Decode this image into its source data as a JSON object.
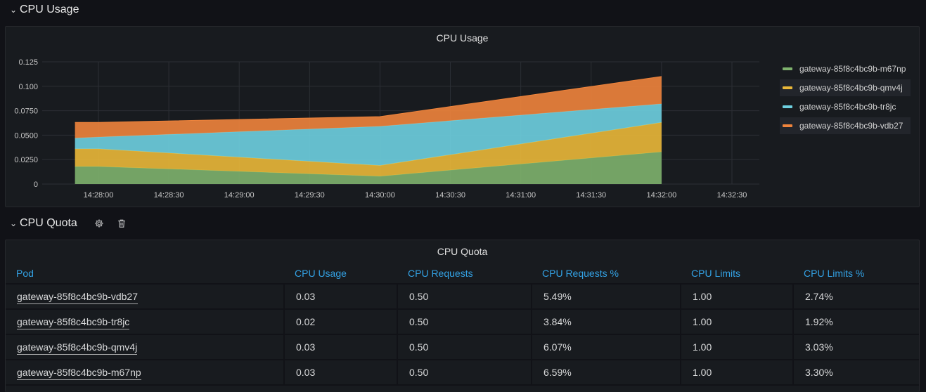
{
  "rows": {
    "cpu_usage": {
      "title": "CPU Usage"
    },
    "cpu_quota": {
      "title": "CPU Quota"
    }
  },
  "icons": {
    "chevron": "chevron-down-icon",
    "settings": "gear-icon",
    "delete": "trash-icon"
  },
  "usage_panel": {
    "title": "CPU Usage",
    "legend": [
      {
        "name": "gateway-85f8c4bc9b-m67np",
        "color": "#7eb26d"
      },
      {
        "name": "gateway-85f8c4bc9b-qmv4j",
        "color": "#eab839"
      },
      {
        "name": "gateway-85f8c4bc9b-tr8jc",
        "color": "#6ed0e0"
      },
      {
        "name": "gateway-85f8c4bc9b-vdb27",
        "color": "#ef843c"
      }
    ]
  },
  "chart_data": {
    "type": "area",
    "title": "CPU Usage",
    "stacked": true,
    "x_ticks": [
      "14:28:00",
      "14:28:30",
      "14:29:00",
      "14:29:30",
      "14:30:00",
      "14:30:30",
      "14:31:00",
      "14:31:30",
      "14:32:00",
      "14:32:30"
    ],
    "y_ticks": [
      "0",
      "0.0250",
      "0.0500",
      "0.0750",
      "0.100",
      "0.125"
    ],
    "ylim": [
      0,
      0.125
    ],
    "x": [
      "14:27:50",
      "14:28:00",
      "14:30:00",
      "14:32:00"
    ],
    "series": [
      {
        "name": "gateway-85f8c4bc9b-m67np",
        "color": "#7eb26d",
        "values": [
          0.018,
          0.018,
          0.008,
          0.033
        ]
      },
      {
        "name": "gateway-85f8c4bc9b-qmv4j",
        "color": "#eab839",
        "values": [
          0.018,
          0.018,
          0.011,
          0.03
        ]
      },
      {
        "name": "gateway-85f8c4bc9b-tr8jc",
        "color": "#6ed0e0",
        "values": [
          0.011,
          0.012,
          0.04,
          0.019
        ]
      },
      {
        "name": "gateway-85f8c4bc9b-vdb27",
        "color": "#ef843c",
        "values": [
          0.016,
          0.015,
          0.01,
          0.028
        ]
      }
    ],
    "grid": true,
    "legend_position": "right"
  },
  "quota_panel": {
    "title": "CPU Quota",
    "columns": [
      "Pod",
      "CPU Usage",
      "CPU Requests",
      "CPU Requests %",
      "CPU Limits",
      "CPU Limits %"
    ],
    "rows": [
      [
        "gateway-85f8c4bc9b-vdb27",
        "0.03",
        "0.50",
        "5.49%",
        "1.00",
        "2.74%"
      ],
      [
        "gateway-85f8c4bc9b-tr8jc",
        "0.02",
        "0.50",
        "3.84%",
        "1.00",
        "1.92%"
      ],
      [
        "gateway-85f8c4bc9b-qmv4j",
        "0.03",
        "0.50",
        "6.07%",
        "1.00",
        "3.03%"
      ],
      [
        "gateway-85f8c4bc9b-m67np",
        "0.03",
        "0.50",
        "6.59%",
        "1.00",
        "3.30%"
      ]
    ]
  }
}
